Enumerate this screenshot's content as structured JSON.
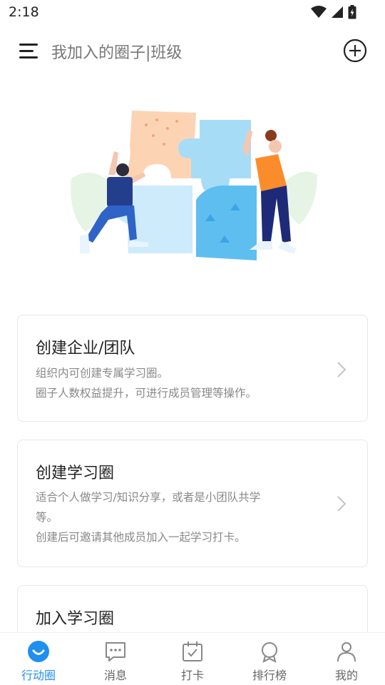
{
  "status_bar": {
    "time": "2:18"
  },
  "header": {
    "title": "我加入的圈子|班级"
  },
  "cards": [
    {
      "title": "创建企业/团队",
      "desc": [
        "组织内可创建专属学习圈。",
        "圈子人数权益提升，可进行成员管理等操作。"
      ]
    },
    {
      "title": "创建学习圈",
      "desc": [
        "适合个人做学习/知识分享，或者是小团队共学",
        "等。",
        "创建后可邀请其他成员加入一起学习打卡。"
      ]
    },
    {
      "title": "加入学习圈"
    }
  ],
  "tabbar": {
    "items": [
      {
        "label": "行动圈",
        "icon": "circle-smile-icon",
        "active": true
      },
      {
        "label": "消息",
        "icon": "message-icon",
        "active": false
      },
      {
        "label": "打卡",
        "icon": "calendar-check-icon",
        "active": false
      },
      {
        "label": "排行榜",
        "icon": "rank-icon",
        "active": false
      },
      {
        "label": "我的",
        "icon": "user-icon",
        "active": false
      }
    ]
  },
  "colors": {
    "accent": "#1f8ff0",
    "text": "#222222",
    "muted": "#888888",
    "border": "#e8e8e8"
  }
}
